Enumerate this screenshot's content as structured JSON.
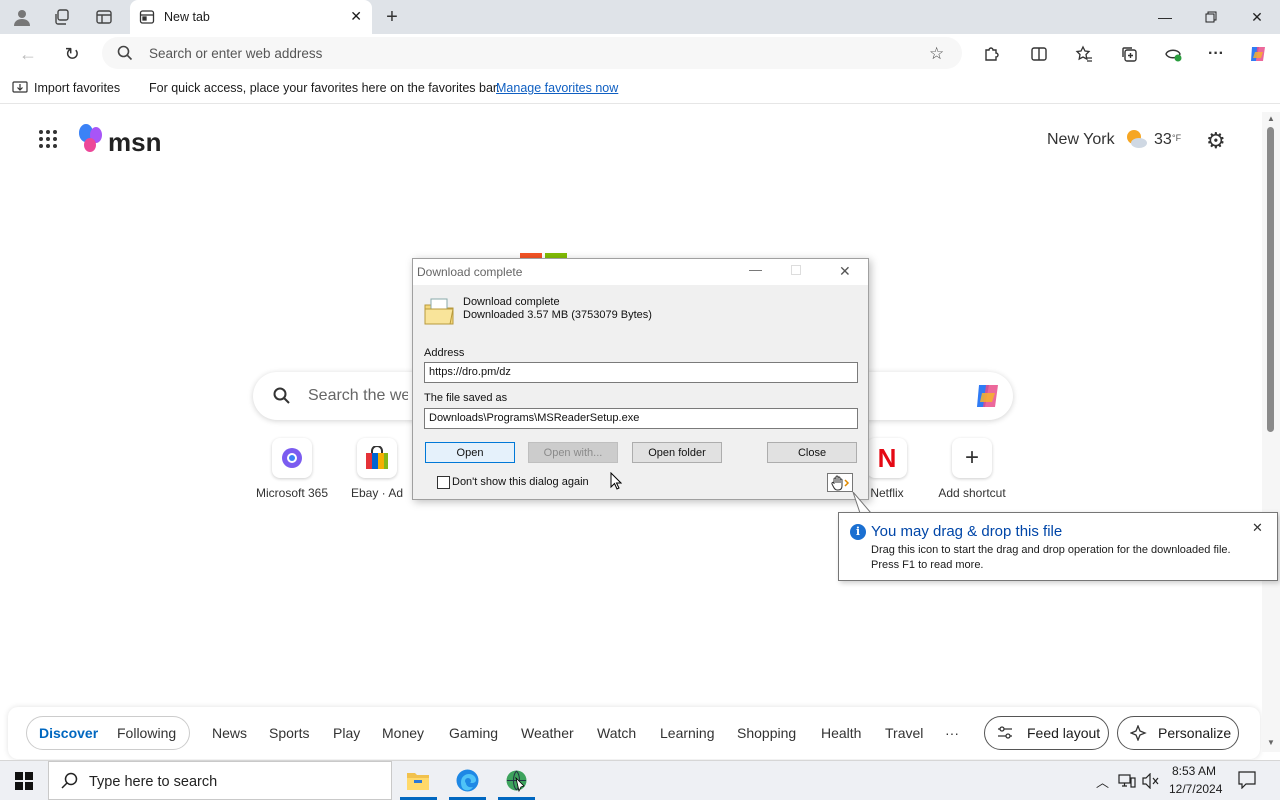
{
  "browser": {
    "tab_title": "New tab",
    "address_placeholder": "Search or enter web address",
    "favorites": {
      "import_label": "Import favorites",
      "message": "For quick access, place your favorites here on the favorites bar.",
      "manage_link": "Manage favorites now"
    }
  },
  "msn": {
    "logo_text": "msn",
    "city": "New York",
    "temperature": "33",
    "temp_unit": "°F",
    "search_placeholder": "Search the web",
    "shortcuts": [
      {
        "label": "Microsoft 365"
      },
      {
        "label": "Ebay · Ad"
      },
      {
        "label": "Netflix"
      },
      {
        "label": "Add shortcut"
      }
    ],
    "nav": {
      "discover": "Discover",
      "following": "Following",
      "items": [
        "News",
        "Sports",
        "Play",
        "Money",
        "Gaming",
        "Weather",
        "Watch",
        "Learning",
        "Shopping",
        "Health",
        "Travel"
      ],
      "more": "···",
      "feed_layout": "Feed layout",
      "personalize": "Personalize"
    }
  },
  "dialog": {
    "title": "Download complete",
    "heading": "Download complete",
    "detail": "Downloaded 3.57  MB (3753079 Bytes)",
    "address_label": "Address",
    "address_value": "https://dro.pm/dz",
    "saved_label": "The file saved as",
    "saved_value": "Downloads\\Programs\\MSReaderSetup.exe",
    "buttons": {
      "open": "Open",
      "open_with": "Open with...",
      "open_folder": "Open folder",
      "close": "Close"
    },
    "checkbox_label": "Don't show this dialog again"
  },
  "tooltip": {
    "title": "You may drag & drop this file",
    "line1": "Drag this icon to start the drag and drop operation for the downloaded file.",
    "line2": "Press F1 to read more."
  },
  "taskbar": {
    "search_placeholder": "Type here to search",
    "time": "8:53 AM",
    "date": "12/7/2024"
  },
  "colors": {
    "accent": "#0067c0",
    "titlebar": "#dfe3e8"
  }
}
